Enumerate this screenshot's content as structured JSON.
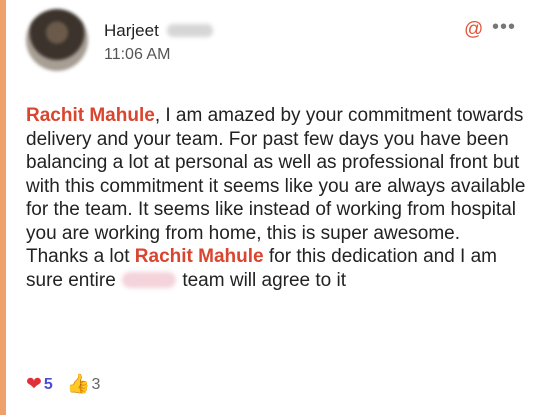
{
  "post": {
    "author": "Harjeet",
    "timestamp": "11:06 AM",
    "message": {
      "mention_1": "Rachit Mahule",
      "text_1": ", I am amazed by your commitment towards delivery and your team. For past few days you have been balancing a lot at personal as well as professional front but with this commitment it seems like you are always available for the team.  It seems like instead of working from hospital you are working from home,  this is super awesome. Thanks a lot ",
      "mention_2": "Rachit Mahule",
      "text_2": " for this dedication and I am sure entire ",
      "text_3": " team will agree to it"
    }
  },
  "reactions": [
    {
      "icon": "heart-icon",
      "count": "5"
    },
    {
      "icon": "thumbs-up-icon",
      "count": "3"
    }
  ],
  "icons": {
    "mention": "@",
    "more": "•••",
    "heart": "❤",
    "thumbs": "👍"
  },
  "colors": {
    "accent_bar": "#f0a06b",
    "mention": "#d9452e",
    "heart": "#e0303a",
    "heart_count": "#4a4fd1"
  }
}
